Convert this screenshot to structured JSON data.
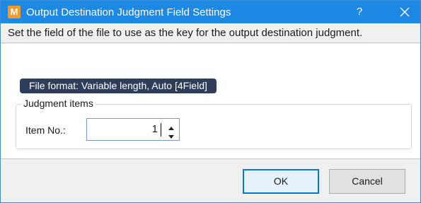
{
  "window": {
    "app_icon_letter": "M",
    "title": "Output Destination Judgment Field Settings",
    "help_label": "?",
    "close_icon": "close-icon"
  },
  "description": "Set the field of the file to use as the key for the output destination judgment.",
  "file_format": "File format: Variable length, Auto [4Field]",
  "judgment_group": {
    "legend": "Judgment items",
    "item_no_label": "Item No.:",
    "item_no_value": "1"
  },
  "buttons": {
    "ok": "OK",
    "cancel": "Cancel"
  },
  "colors": {
    "titlebar": "#1e88e5",
    "app_icon": "#f59a23",
    "badge": "#2c3e5a"
  }
}
